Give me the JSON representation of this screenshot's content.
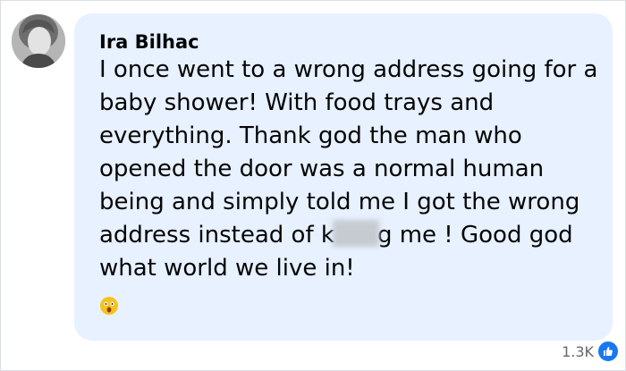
{
  "comment": {
    "author": "Ira Bilhac",
    "text_part1": "I once went to a wrong address going for a baby shower! With food trays and everything. Thank god the man who opened the door was a normal human being and simply told me I got the wrong address instead of k",
    "text_part2": "g me ! Good god what world we live in!",
    "emoji": "astonished-face-icon"
  },
  "reactions": {
    "count": "1.3K",
    "icon": "like-icon",
    "color": "#1877f2"
  },
  "colors": {
    "bubble": "#e7f1ff",
    "text": "#050505"
  }
}
